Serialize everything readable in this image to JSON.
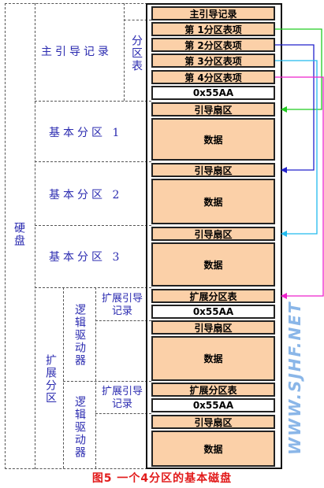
{
  "left_labels": {
    "disk": "硬盘",
    "mbr": "主引导记录",
    "partition_table": "分区表",
    "primary1": "基本分区 1",
    "primary2": "基本分区 2",
    "primary3": "基本分区 3",
    "extended": "扩展分区",
    "logical_drive_a": "逻辑驱动器",
    "logical_drive_b": "逻辑驱动器",
    "ext_boot_record_a": "扩展引导记录",
    "ext_boot_record_b": "扩展引导记录"
  },
  "blocks": {
    "mbr_title": "主引导记录",
    "entry1": "第 1分区表项",
    "entry2": "第 2分区表项",
    "entry3": "第 3分区表项",
    "entry4": "第 4分区表项",
    "sig1": "0x55AA",
    "boot1": "引导扇区",
    "data1": "数据",
    "boot2": "引导扇区",
    "data2": "数据",
    "boot3": "引导扇区",
    "data3": "数据",
    "ext_table1": "扩展分区表",
    "sig2": "0x55AA",
    "boot4": "引导扇区",
    "data4": "数据",
    "ext_table2": "扩展分区表",
    "sig3": "0x55AA",
    "boot5": "引导扇区",
    "data5": "数据"
  },
  "colors": {
    "arrow1": "#22cc22",
    "arrow2": "#2222cc",
    "arrow3": "#22bbee",
    "arrow4": "#ee22cc",
    "cell_fill": "#fbd0a8",
    "caption": "#e21b1b",
    "label": "#2b2bb0"
  },
  "caption": "图5  一个4分区的基本磁盘",
  "watermark": "WWW.SJHF.NET"
}
